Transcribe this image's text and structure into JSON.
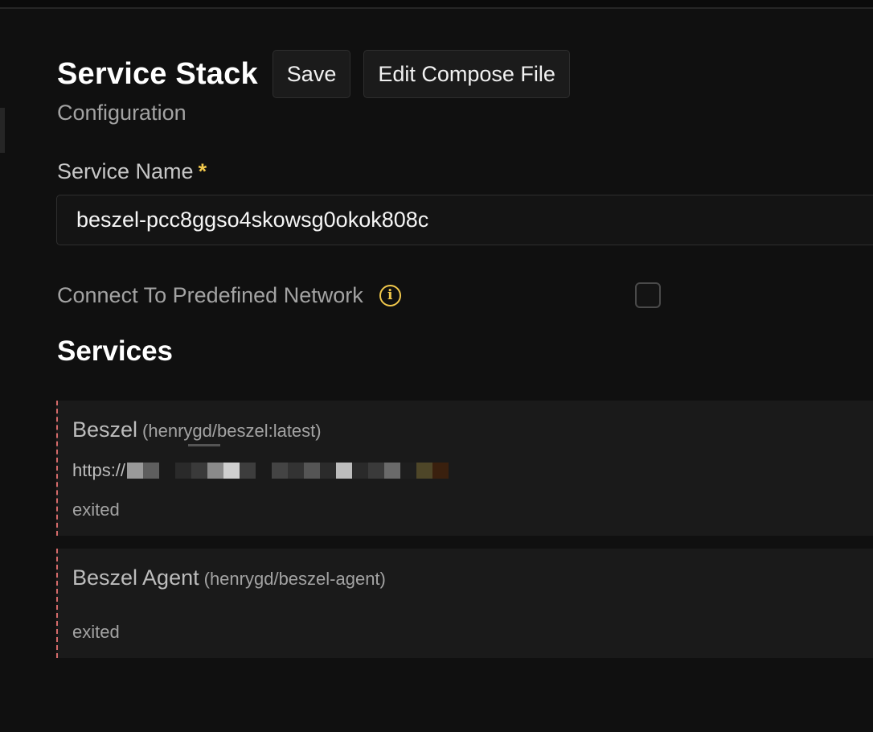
{
  "header": {
    "title": "Service Stack",
    "save_label": "Save",
    "edit_compose_label": "Edit Compose File",
    "subtitle": "Configuration"
  },
  "form": {
    "service_name_label": "Service Name",
    "required_marker": "*",
    "service_name_value": "beszel-pcc8ggso4skowsg0okok808c",
    "network_label": "Connect To Predefined Network",
    "network_checked": false
  },
  "services": {
    "title": "Services",
    "items": [
      {
        "name": "Beszel",
        "image": "(henrygd/beszel:latest)",
        "url_prefix": "https://",
        "status": "exited"
      },
      {
        "name": "Beszel Agent",
        "image": "(henrygd/beszel-agent)",
        "status": "exited"
      }
    ]
  },
  "colors": {
    "accent": "#f2c94c",
    "dashed_border": "#d46a6a",
    "background": "#101010"
  }
}
